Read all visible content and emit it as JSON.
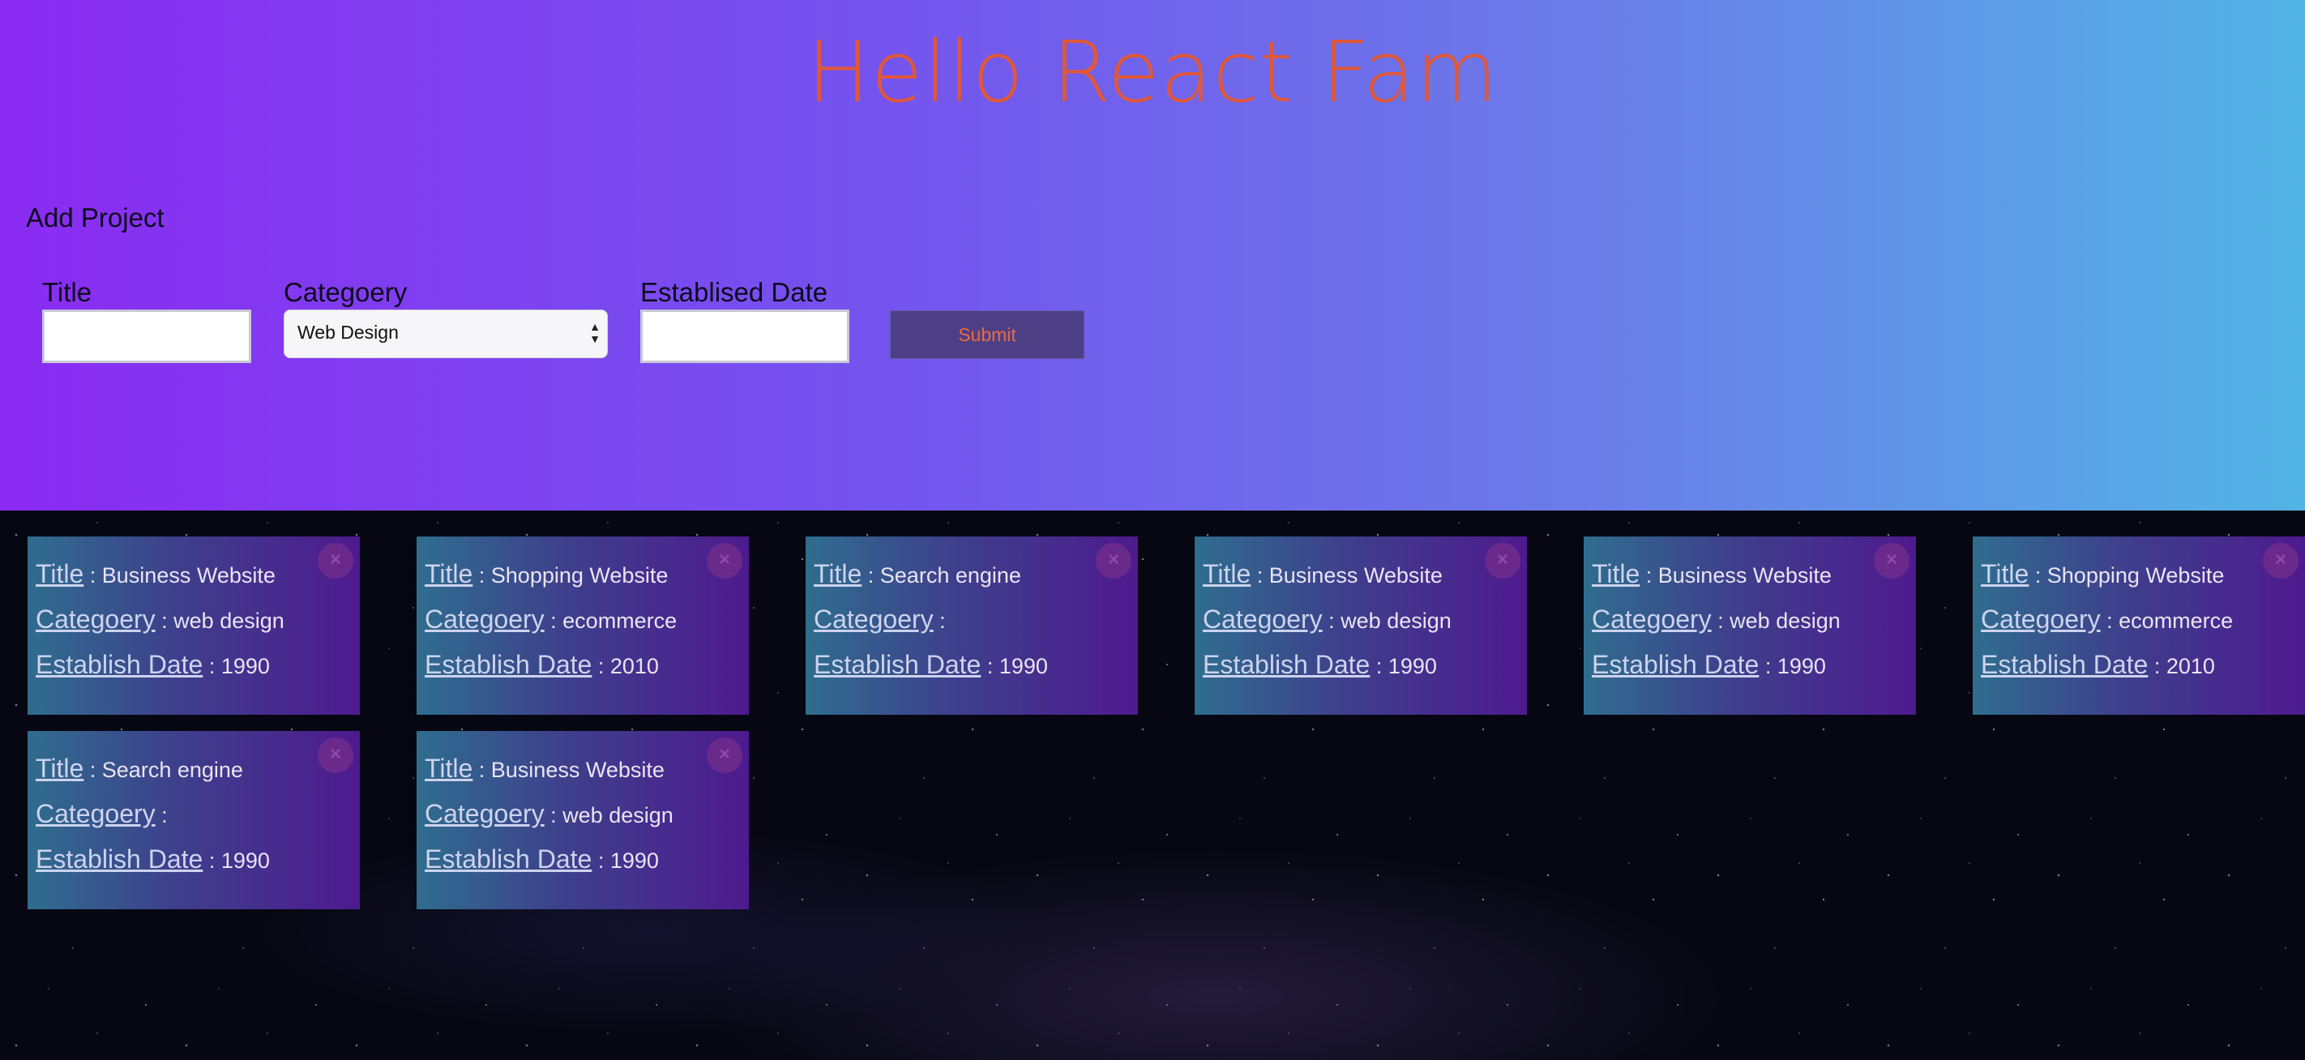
{
  "header": {
    "title": "Hello React Fam"
  },
  "form": {
    "heading": "Add Project",
    "title_label": "Title",
    "title_value": "",
    "category_label": "Categoery",
    "category_selected": "Web Design",
    "date_label": "Establised Date",
    "date_value": "",
    "submit_label": "Submit"
  },
  "card_labels": {
    "title": "Title",
    "category": "Categoery",
    "date": "Establish Date",
    "sep": " : "
  },
  "projects": [
    {
      "title": "Business Website",
      "category": "web design",
      "date": "1990"
    },
    {
      "title": "Shopping Website",
      "category": "ecommerce",
      "date": "2010"
    },
    {
      "title": "Search engine",
      "category": "",
      "date": "1990"
    },
    {
      "title": "Business Website",
      "category": "web design",
      "date": "1990"
    },
    {
      "title": "Business Website",
      "category": "web design",
      "date": "1990"
    },
    {
      "title": "Shopping Website",
      "category": "ecommerce",
      "date": "2010"
    },
    {
      "title": "Search engine",
      "category": "",
      "date": "1990"
    },
    {
      "title": "Business Website",
      "category": "web design",
      "date": "1990"
    }
  ],
  "icons": {
    "close": "close-icon",
    "select_arrows": "updown-arrow-icon"
  },
  "colors": {
    "title": "#e0583a",
    "submit_text": "#ea6a3f",
    "card_start": "#2f6d8e",
    "card_end": "#4e1a8f"
  }
}
